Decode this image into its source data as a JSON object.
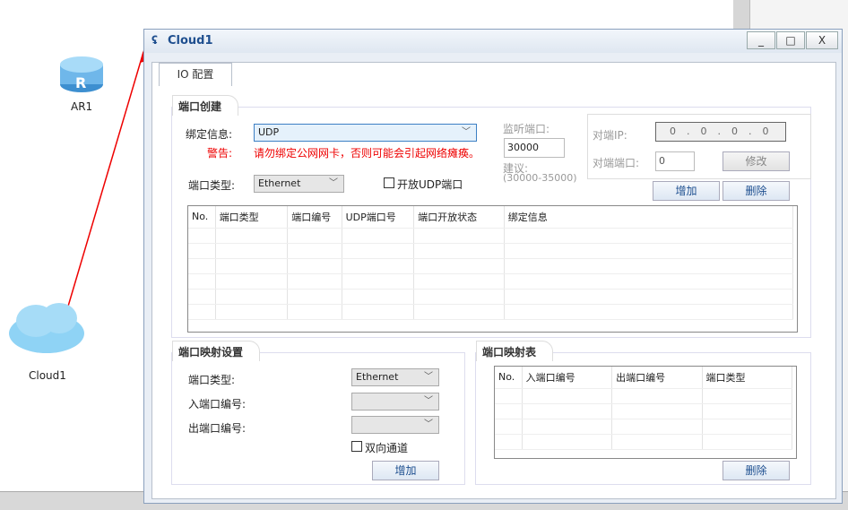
{
  "canvas": {
    "router_label": "AR1",
    "cloud_label": "Cloud1"
  },
  "dialog": {
    "title": "Cloud1",
    "controls": {
      "minimize": "_",
      "maximize": "□",
      "close": "X"
    },
    "tab": "IO 配置",
    "port_create": {
      "title": "端口创建",
      "bind_label": "绑定信息:",
      "bind_value": "UDP",
      "warning_label": "警告:",
      "warning_text": "请勿绑定公网网卡，否则可能会引起网络瘫痪。",
      "port_type_label": "端口类型:",
      "port_type_value": "Ethernet",
      "open_udp_label": "开放UDP端口",
      "open_udp_checked": false,
      "listen_label": "监听端口:",
      "listen_value": "30000",
      "suggest_label": "建议:",
      "suggest_range": "(30000-35000)",
      "peer_ip_label": "对端IP:",
      "peer_ip": [
        "0",
        "0",
        "0",
        "0"
      ],
      "peer_port_label": "对端端口:",
      "peer_port_value": "0",
      "modify_button": "修改",
      "add_button": "增加",
      "delete_button": "删除",
      "columns": [
        "No.",
        "端口类型",
        "端口编号",
        "UDP端口号",
        "端口开放状态",
        "绑定信息"
      ]
    },
    "port_map_settings": {
      "title": "端口映射设置",
      "port_type_label": "端口类型:",
      "port_type_value": "Ethernet",
      "in_port_label": "入端口编号:",
      "out_port_label": "出端口编号:",
      "bidirectional_label": "双向通道",
      "bidirectional_checked": false,
      "add_button": "增加"
    },
    "port_map_table": {
      "title": "端口映射表",
      "columns": [
        "No.",
        "入端口编号",
        "出端口编号",
        "端口类型"
      ],
      "delete_button": "删除"
    }
  },
  "colors": {
    "annotation_arrow": "#ee0000",
    "warning": "#ee0000",
    "title": "#1f4f8f"
  }
}
